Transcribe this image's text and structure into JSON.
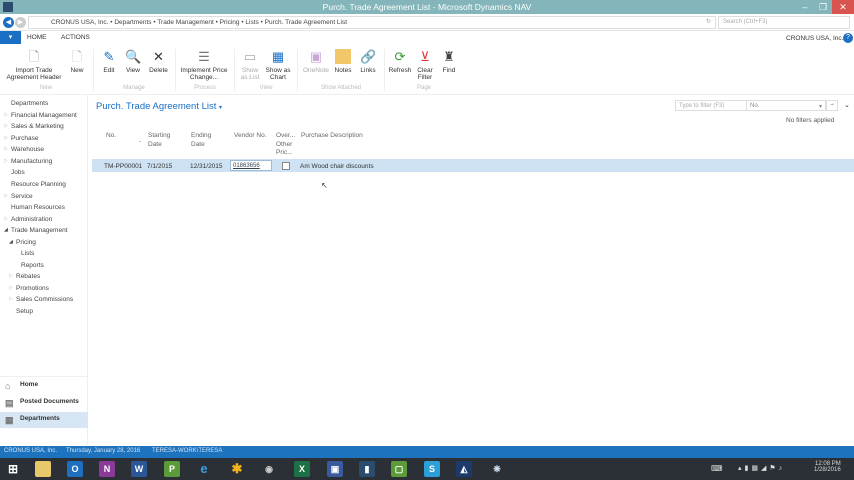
{
  "window": {
    "title": "Purch. Trade Agreement List - Microsoft Dynamics NAV"
  },
  "address": {
    "breadcrumb": "CRONUS USA, Inc.  •  Departments  •  Trade Management  •  Pricing  •  Lists  •  Purch. Trade Agreement List",
    "search_placeholder": "Search (Ctrl+F3)"
  },
  "tabs": [
    "HOME",
    "ACTIONS"
  ],
  "company": "CRONUS USA, Inc.",
  "ribbon": {
    "buttons": [
      {
        "label": "Import Trade Agreement Header"
      },
      {
        "label": "New"
      },
      {
        "label": "Edit"
      },
      {
        "label": "View"
      },
      {
        "label": "Delete"
      },
      {
        "label": "Implement Price Change..."
      },
      {
        "label": "Show as List"
      },
      {
        "label": "Show as Chart"
      },
      {
        "label": "OneNote"
      },
      {
        "label": "Notes"
      },
      {
        "label": "Links"
      },
      {
        "label": "Refresh"
      },
      {
        "label": "Clear Filter"
      },
      {
        "label": "Find"
      }
    ],
    "groups": [
      "New",
      "Manage",
      "Process",
      "View",
      "Show Attached",
      "Page"
    ]
  },
  "page": {
    "title": "Purch. Trade Agreement List",
    "filter_placeholder": "Type to filter (F3)",
    "filter_field": "No.",
    "filter_status": "No filters applied"
  },
  "table": {
    "headers": [
      "No.",
      "Starting Date",
      "Ending Date",
      "Vendor No.",
      "Over... Other Pric...",
      "Purchase Description"
    ],
    "rows": [
      {
        "no": "TM-PP00001",
        "start": "7/1/2015",
        "end": "12/31/2015",
        "vendor": "01863656",
        "desc": "Am Wood chair discounts"
      }
    ]
  },
  "nav": {
    "items": [
      "Departments",
      "Financial Management",
      "Sales & Marketing",
      "Purchase",
      "Warehouse",
      "Manufacturing",
      "Jobs",
      "Resource Planning",
      "Service",
      "Human Resources",
      "Administration",
      "Trade Management",
      "Pricing",
      "Lists",
      "Reports",
      "Rebates",
      "Promotions",
      "Sales Commissions",
      "Setup"
    ],
    "bottom": [
      "Home",
      "Posted Documents",
      "Departments"
    ]
  },
  "status": {
    "company": "CRONUS USA, Inc.",
    "date": "Thursday, January 28, 2016",
    "user": "TERESA-WORK\\TERESA"
  },
  "clock": {
    "time": "12:08 PM",
    "date": "1/28/2016"
  }
}
